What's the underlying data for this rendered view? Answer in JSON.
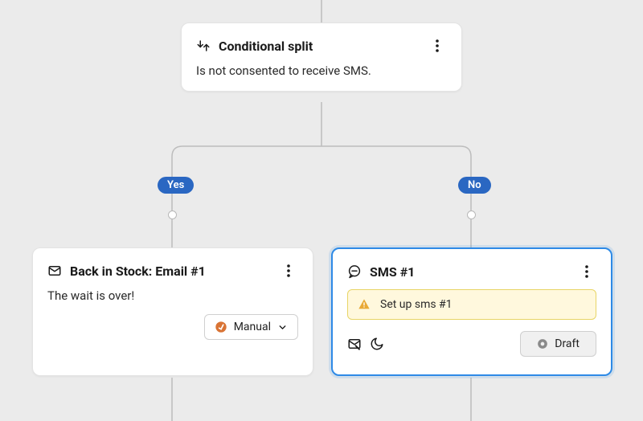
{
  "conditional": {
    "title": "Conditional split",
    "description": "Is not consented to receive SMS."
  },
  "branches": {
    "yes": "Yes",
    "no": "No"
  },
  "emailCard": {
    "title": "Back in Stock: Email #1",
    "description": "The wait is over!",
    "sendMode": "Manual"
  },
  "smsCard": {
    "title": "SMS #1",
    "warning": "Set up sms #1",
    "status": "Draft"
  }
}
